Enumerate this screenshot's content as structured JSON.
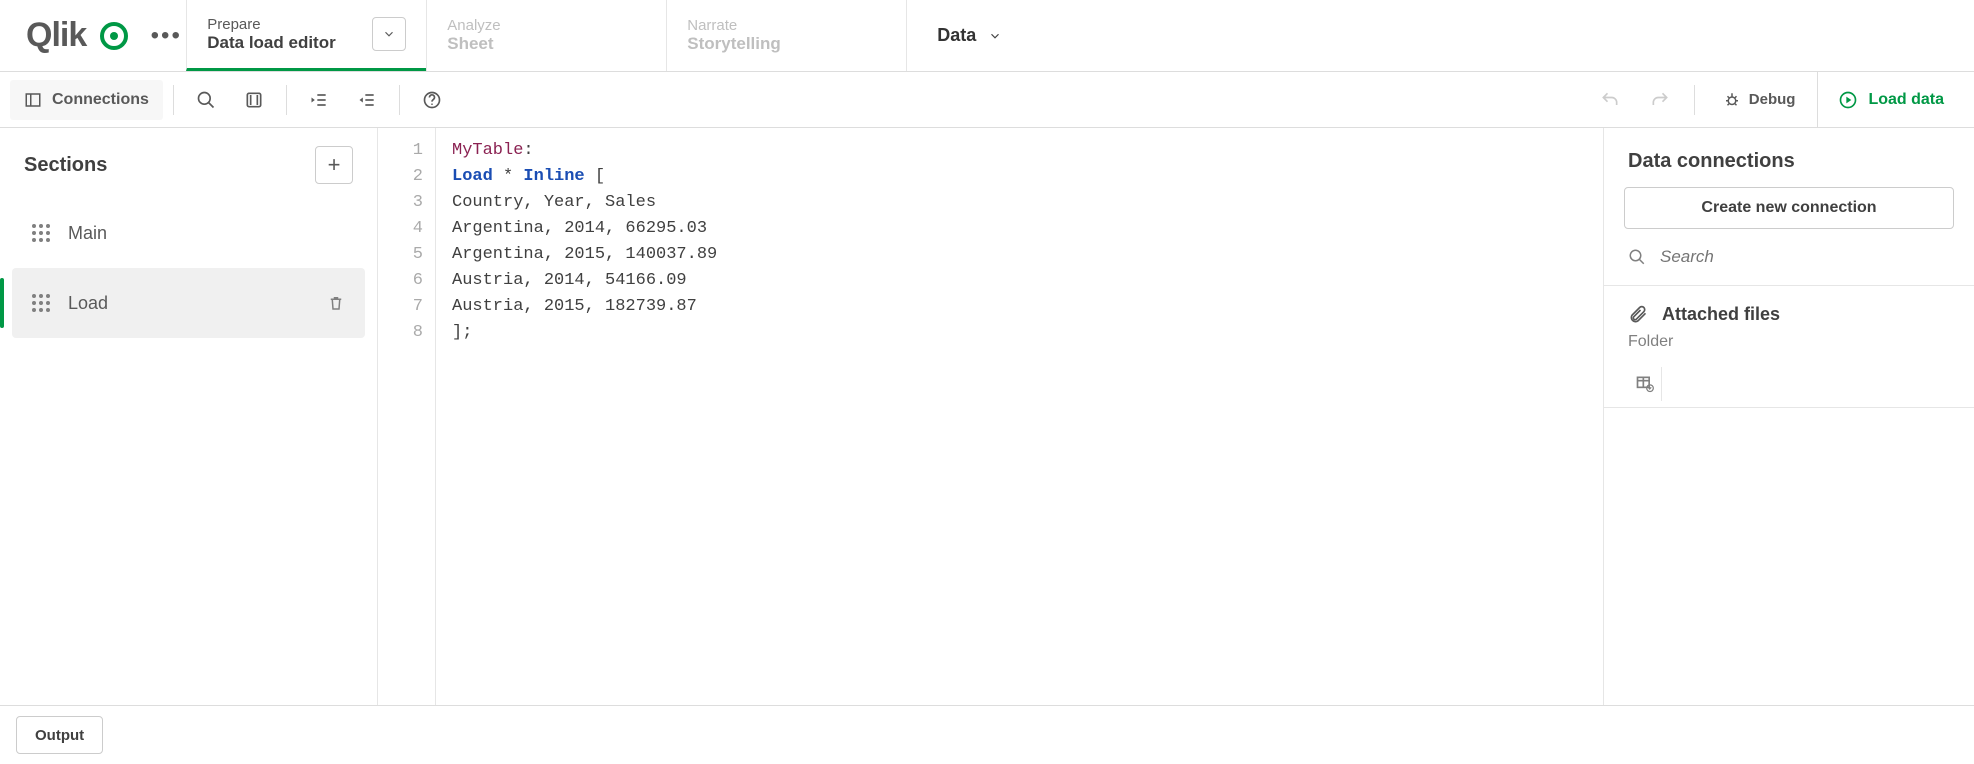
{
  "header": {
    "logo_text": "Qlik",
    "nav": [
      {
        "small": "Prepare",
        "big": "Data load editor",
        "active": true,
        "has_chevron": true
      },
      {
        "small": "Analyze",
        "big": "Sheet",
        "active": false,
        "has_chevron": false
      },
      {
        "small": "Narrate",
        "big": "Storytelling",
        "active": false,
        "has_chevron": false
      }
    ],
    "data_dropdown": "Data"
  },
  "toolbar": {
    "connections_label": "Connections",
    "debug_label": "Debug",
    "load_label": "Load data"
  },
  "sections": {
    "title": "Sections",
    "items": [
      {
        "label": "Main",
        "active": false
      },
      {
        "label": "Load",
        "active": true
      }
    ]
  },
  "editor": {
    "line_numbers": [
      "1",
      "2",
      "3",
      "4",
      "5",
      "6",
      "7",
      "8"
    ],
    "code": {
      "table_label": "MyTable",
      "load_kw": "Load",
      "star": "*",
      "inline_kw": "Inline",
      "open_bracket": "[",
      "header_row": "Country, Year, Sales",
      "rows": [
        "Argentina, 2014, 66295.03",
        "Argentina, 2015, 140037.89",
        "Austria, 2014, 54166.09",
        "Austria, 2015, 182739.87"
      ],
      "close": "];"
    }
  },
  "connections": {
    "title": "Data connections",
    "create_label": "Create new connection",
    "search_placeholder": "Search",
    "attached_label": "Attached files",
    "folder_label": "Folder"
  },
  "footer": {
    "output_label": "Output"
  }
}
